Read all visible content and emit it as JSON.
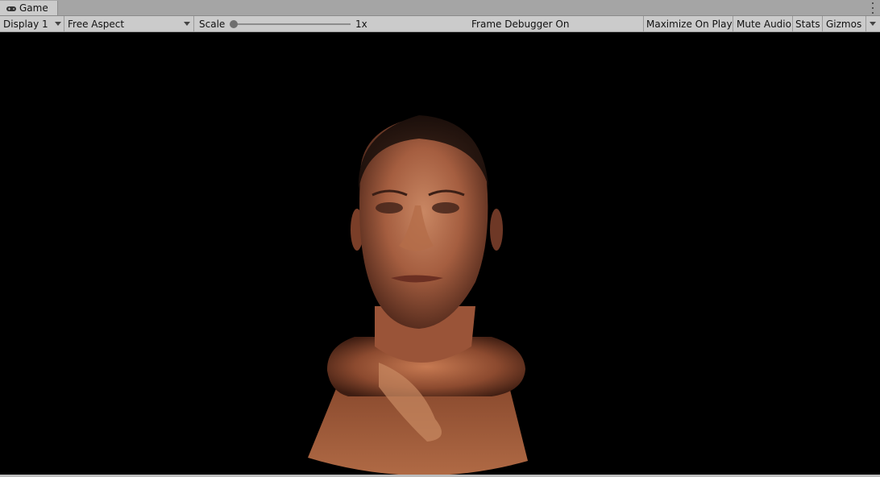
{
  "tab": {
    "label": "Game",
    "icon": "gamepad-icon"
  },
  "toolbar": {
    "display": "Display 1",
    "aspect": "Free Aspect",
    "scale_label": "Scale",
    "scale_value": "1x",
    "scale_level": 0.0,
    "frame_debugger": "Frame Debugger On",
    "maximize": "Maximize On Play",
    "mute": "Mute Audio",
    "stats": "Stats",
    "gizmos": "Gizmos"
  },
  "colors": {
    "toolbar_bg": "#cbcbcb",
    "tabbar_bg": "#a5a5a5",
    "viewport_bg": "#000000",
    "skin": "#b36a45"
  }
}
